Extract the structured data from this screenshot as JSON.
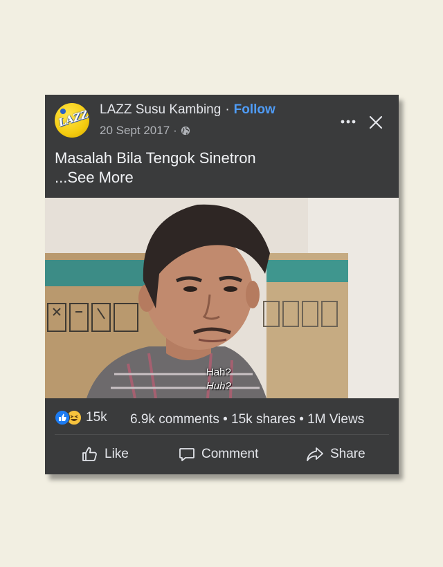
{
  "post": {
    "page_name": "LAZZ Susu Kambing",
    "follow_label": "Follow",
    "separator": "·",
    "date": "20 Sept 2017",
    "privacy_icon": "globe-icon",
    "avatar_text": "LAZZ",
    "caption": "Masalah Bila Tengok Sinetron",
    "see_more": "...See More"
  },
  "video": {
    "subtitle_line1": "Hah?",
    "subtitle_line2": "Huh?"
  },
  "stats": {
    "reaction_count": "15k",
    "summary": "6.9k comments • 15k shares • 1M Views",
    "reaction_icons": [
      "like-icon",
      "haha-icon"
    ]
  },
  "actions": {
    "like": "Like",
    "comment": "Comment",
    "share": "Share"
  },
  "colors": {
    "card_bg": "#3a3b3c",
    "follow": "#4f9cf7",
    "like_reaction": "#1d7cf2",
    "haha_reaction": "#f7c33d"
  }
}
